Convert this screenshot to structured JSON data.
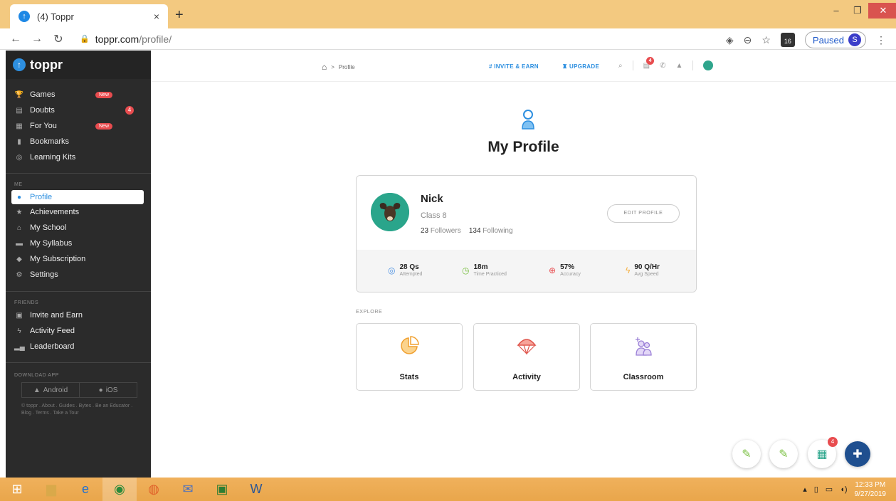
{
  "browser": {
    "tab_title": "(4) Toppr",
    "tab_close": "×",
    "new_tab": "+",
    "url_domain": "toppr.com",
    "url_path": "/profile/",
    "profile_status": "Paused",
    "profile_initial": "S",
    "extension_count": "16"
  },
  "sidebar": {
    "brand": "toppr",
    "top_items": [
      {
        "label": "Games",
        "icon": "trophy-icon",
        "badge": "New"
      },
      {
        "label": "Doubts",
        "icon": "chat-icon",
        "badge": "4"
      },
      {
        "label": "For You",
        "icon": "grid-icon",
        "badge": "New"
      },
      {
        "label": "Bookmarks",
        "icon": "bookmark-icon"
      },
      {
        "label": "Learning Kits",
        "icon": "kit-icon"
      }
    ],
    "me_section": "ME",
    "me_items": [
      {
        "label": "Profile",
        "icon": "user-icon",
        "active": true
      },
      {
        "label": "Achievements",
        "icon": "star-icon"
      },
      {
        "label": "My School",
        "icon": "school-icon"
      },
      {
        "label": "My Syllabus",
        "icon": "book-icon"
      },
      {
        "label": "My Subscription",
        "icon": "tag-icon"
      },
      {
        "label": "Settings",
        "icon": "gear-icon"
      }
    ],
    "friends_section": "FRIENDS",
    "friends_items": [
      {
        "label": "Invite and Earn",
        "icon": "gift-icon"
      },
      {
        "label": "Activity Feed",
        "icon": "bolt-icon"
      },
      {
        "label": "Leaderboard",
        "icon": "bars-icon"
      }
    ],
    "download_section": "DOWNLOAD APP",
    "android": "Android",
    "ios": "iOS",
    "footer": "© toppr . About . Guides . Bytes . Be an Educator . Blog . Terms . Take a Tour"
  },
  "topnav": {
    "breadcrumb_sep": ">",
    "breadcrumb": "Profile",
    "invite": "# INVITE & EARN",
    "upgrade": "♜ UPGRADE",
    "notif_count": "4"
  },
  "page": {
    "title": "My Profile",
    "name": "Nick",
    "class": "Class 8",
    "followers_count": "23",
    "followers_label": "Followers",
    "following_count": "134",
    "following_label": "Following",
    "edit_button": "EDIT PROFILE",
    "stats": [
      {
        "value": "28 Qs",
        "label": "Attempted",
        "color": "#4a90e2"
      },
      {
        "value": "18m",
        "label": "Time Practiced",
        "color": "#7bc043"
      },
      {
        "value": "57%",
        "label": "Accuracy",
        "color": "#e84c4f"
      },
      {
        "value": "90 Q/Hr",
        "label": "Avg Speed",
        "color": "#f5b041"
      }
    ],
    "explore_label": "EXPLORE",
    "tiles": [
      {
        "label": "Stats",
        "icon": "pie-chart-icon"
      },
      {
        "label": "Activity",
        "icon": "parachute-icon"
      },
      {
        "label": "Classroom",
        "icon": "classroom-icon"
      }
    ],
    "fab_badge": "4"
  },
  "taskbar": {
    "time": "12:33 PM",
    "date": "9/27/2019"
  }
}
